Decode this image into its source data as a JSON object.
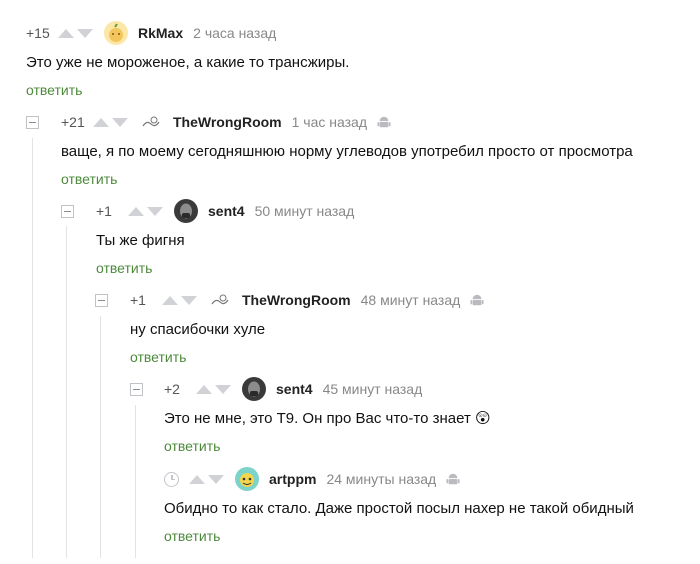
{
  "comments": [
    {
      "rating": "+15",
      "author": "RkMax",
      "time": "2 часа назад",
      "text": "Это уже не мороженое, а какие то трансжиры.",
      "reply": "ответить"
    },
    {
      "rating": "+21",
      "author": "TheWrongRoom",
      "time": "1 час назад",
      "text": "ваще, я по моему сегодняшнюю норму углеводов употребил просто от просмотра",
      "reply": "ответить"
    },
    {
      "rating": "+1",
      "author": "sent4",
      "time": "50 минут назад",
      "text": "Ты же фигня",
      "reply": "ответить"
    },
    {
      "rating": "+1",
      "author": "TheWrongRoom",
      "time": "48 минут назад",
      "text": "ну спасибочки хуле",
      "reply": "ответить"
    },
    {
      "rating": "+2",
      "author": "sent4",
      "time": "45 минут назад",
      "text": "Это не мне, это Т9. Он про Вас что-то знает",
      "emoji": "😲",
      "reply": "ответить"
    },
    {
      "rating": "",
      "author": "artppm",
      "time": "24 минуты назад",
      "text": "Обидно то как стало. Даже простой посыл нахер не такой обидный",
      "reply": "ответить"
    }
  ],
  "colors": {
    "reply_link": "#4d8a3c",
    "vote_arrow": "#d0d2d6",
    "meta_text": "#888888",
    "thread_line": "#e2e3e5"
  },
  "icons": {
    "vote_up": "triangle-up-icon",
    "vote_down": "triangle-down-icon",
    "collapse": "minus-box-icon",
    "platform": "android-icon",
    "pending": "clock-icon"
  }
}
